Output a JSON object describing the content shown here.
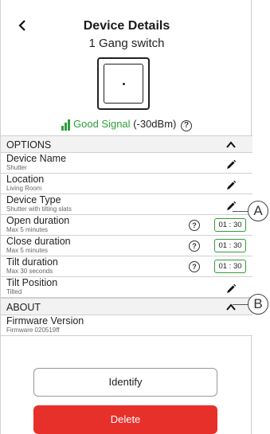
{
  "header": {
    "back_glyph": "<",
    "title": "Device Details",
    "subtitle": "1 Gang switch",
    "device_icon": "switch-icon"
  },
  "signal": {
    "label": "Good Signal",
    "value": "(-30dBm)",
    "help_glyph": "?",
    "color": "#2e9e3a"
  },
  "options": {
    "header": "OPTIONS",
    "rows": [
      {
        "label": "Device Name",
        "sub": "Shutter"
      },
      {
        "label": "Location",
        "sub": "Living Room"
      },
      {
        "label": "Device Type",
        "sub": "Shutter with tilting slats"
      },
      {
        "label": "Open duration",
        "sub": "Max 5 minutes",
        "value": "01 : 30"
      },
      {
        "label": "Close duration",
        "sub": "Max 5 minutes",
        "value": "01 : 30"
      },
      {
        "label": "Tilt duration",
        "sub": "Max 30 seconds",
        "value": "01 : 30"
      },
      {
        "label": "Tilt Position",
        "sub": "Tilted"
      }
    ]
  },
  "about": {
    "header": "ABOUT",
    "rows": [
      {
        "label": "Firmware Version",
        "sub": "Firmware 020519ff"
      }
    ]
  },
  "buttons": {
    "identify": "Identify",
    "delete": "Delete",
    "delete_color": "#e7302a"
  },
  "callouts": {
    "a": "A",
    "b": "B"
  },
  "help_glyph": "?"
}
